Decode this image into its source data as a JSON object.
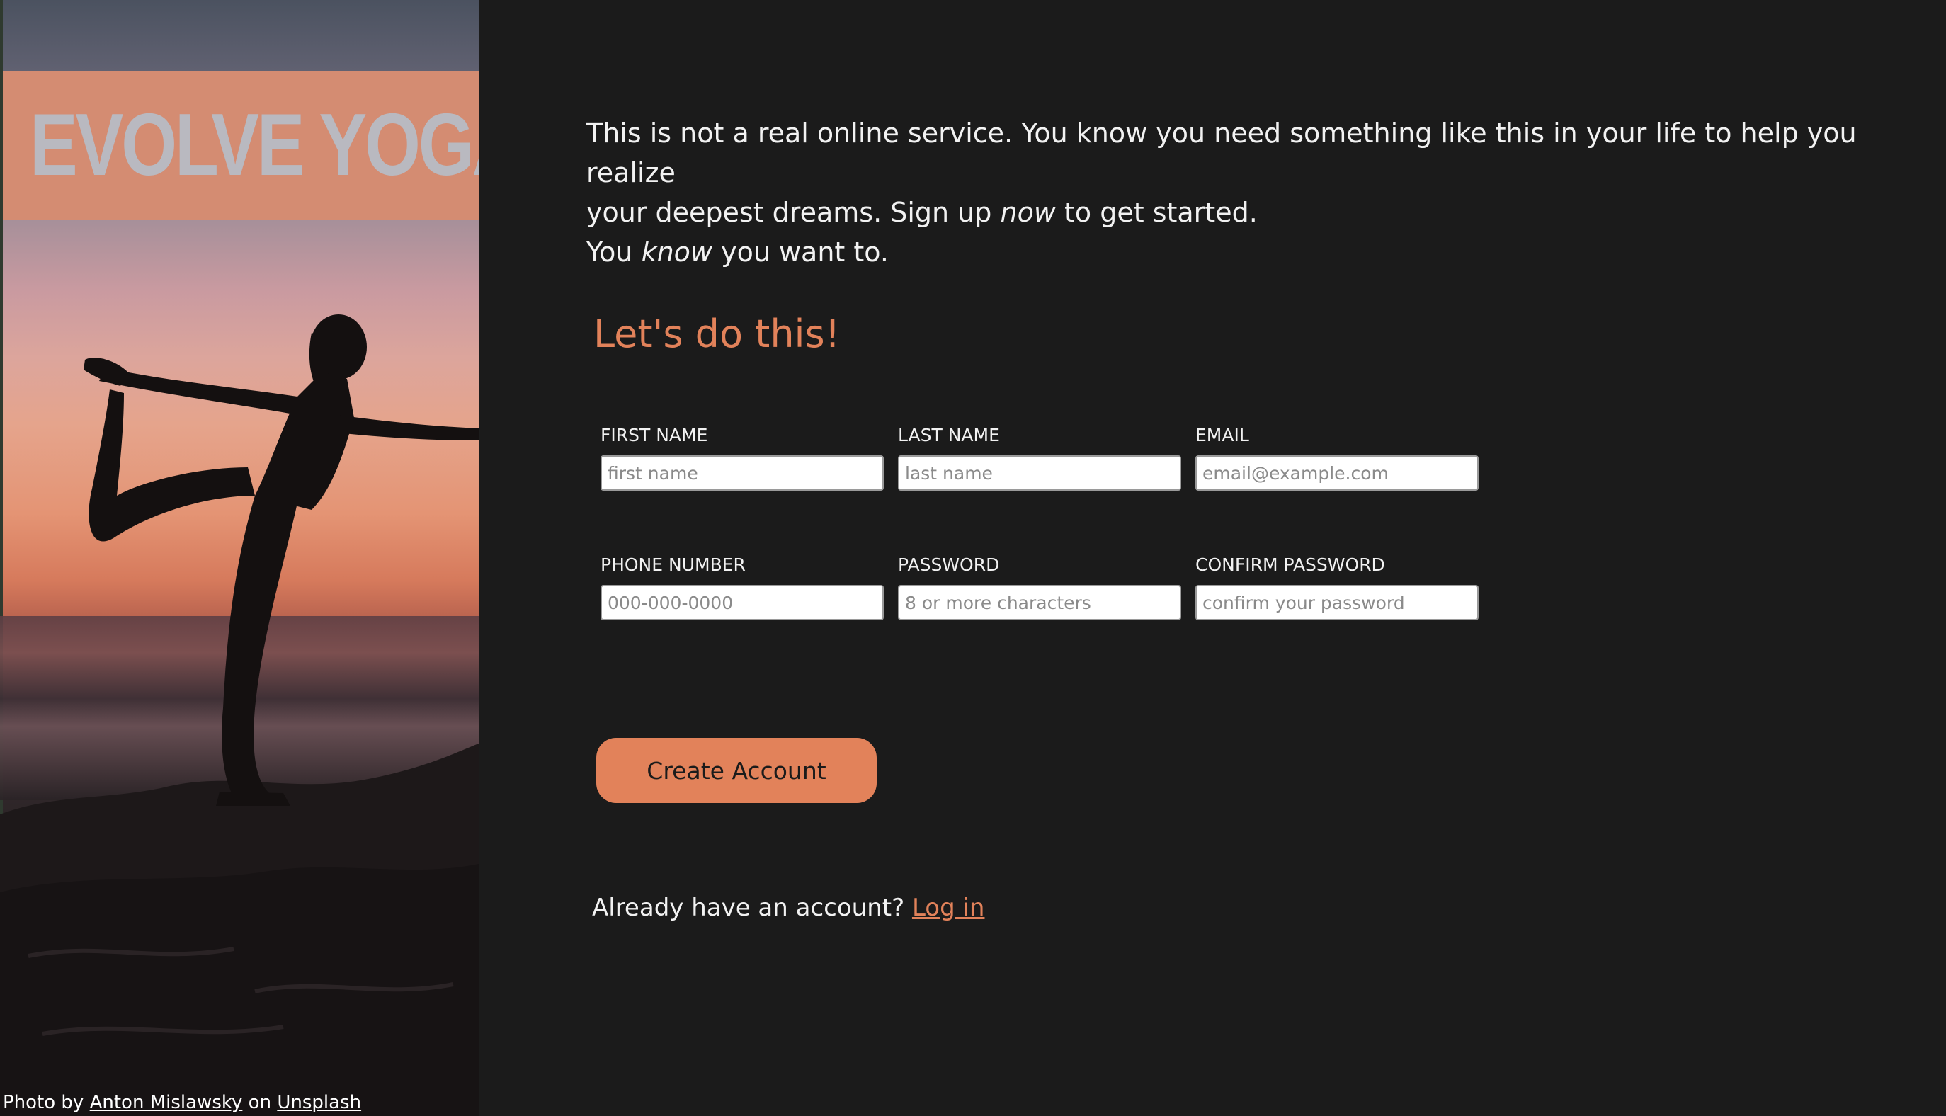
{
  "brand": {
    "name": "EVOLVE YOGA",
    "icon": "flame-icon"
  },
  "credit": {
    "prefix": "Photo by",
    "author": "Anton Mislawsky",
    "joiner": "on",
    "site": "Unsplash"
  },
  "intro": {
    "line1": "This is not a real online service. You know you need something like this in your life to help you realize",
    "line2_a": "your deepest dreams. Sign up ",
    "line2_em": "now",
    "line2_b": " to get started.",
    "line3_a": "You ",
    "line3_em": "know",
    "line3_b": " you want to."
  },
  "form": {
    "heading": "Let's do this!",
    "fields": {
      "first_name": {
        "label": "FIRST NAME",
        "placeholder": "first name",
        "value": ""
      },
      "last_name": {
        "label": "LAST NAME",
        "placeholder": "last name",
        "value": ""
      },
      "email": {
        "label": "EMAIL",
        "placeholder": "email@example.com",
        "value": ""
      },
      "phone": {
        "label": "PHONE NUMBER",
        "placeholder": "000-000-0000",
        "value": ""
      },
      "password": {
        "label": "PASSWORD",
        "placeholder": "8 or more characters",
        "value": ""
      },
      "confirm_password": {
        "label": "CONFIRM PASSWORD",
        "placeholder": "confirm your password",
        "value": ""
      }
    },
    "submit_label": "Create Account"
  },
  "login": {
    "prompt": "Already have an account?",
    "link_label": "Log in"
  },
  "colors": {
    "accent": "#e2825a",
    "background": "#1b1b1b",
    "banner": "#d48c72",
    "brand_text": "#b9b9c0"
  }
}
